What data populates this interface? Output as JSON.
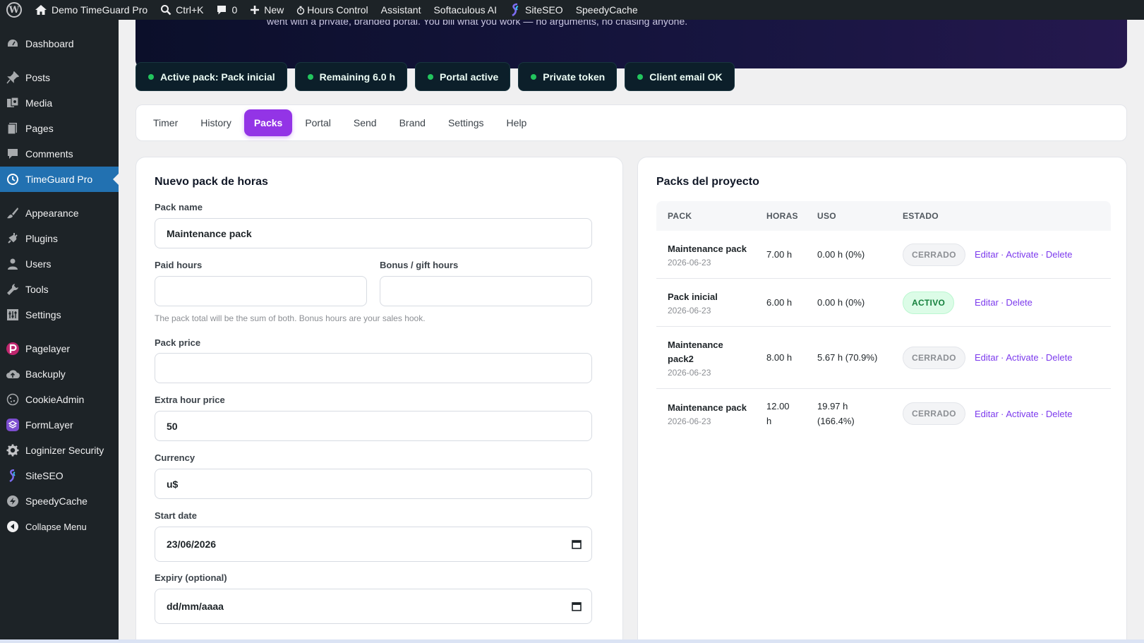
{
  "adminbar": {
    "site_name": "Demo TimeGuard Pro",
    "search_shortcut": "Ctrl+K",
    "comments_count": "0",
    "new_label": "New",
    "hours_control": "Hours Control",
    "assistant": "Assistant",
    "softaculous": "Softaculous AI",
    "siteseo": "SiteSEO",
    "speedycache": "SpeedyCache"
  },
  "sidebar": {
    "items": [
      {
        "label": "Dashboard",
        "icon": "dashboard-icon"
      },
      {
        "label": "Posts",
        "icon": "pin-icon"
      },
      {
        "label": "Media",
        "icon": "media-icon"
      },
      {
        "label": "Pages",
        "icon": "pages-icon"
      },
      {
        "label": "Comments",
        "icon": "comment-icon"
      },
      {
        "label": "TimeGuard Pro",
        "icon": "clock-icon",
        "active": true
      },
      {
        "label": "Appearance",
        "icon": "brush-icon"
      },
      {
        "label": "Plugins",
        "icon": "plug-icon"
      },
      {
        "label": "Users",
        "icon": "user-icon"
      },
      {
        "label": "Tools",
        "icon": "wrench-icon"
      },
      {
        "label": "Settings",
        "icon": "settings-icon"
      },
      {
        "label": "Pagelayer",
        "icon": "pagelayer-icon"
      },
      {
        "label": "Backuply",
        "icon": "cloud-upload-icon"
      },
      {
        "label": "CookieAdmin",
        "icon": "cookie-icon"
      },
      {
        "label": "FormLayer",
        "icon": "formlayer-icon"
      },
      {
        "label": "Loginizer Security",
        "icon": "gear-icon"
      },
      {
        "label": "SiteSEO",
        "icon": "siteseo-icon"
      },
      {
        "label": "SpeedyCache",
        "icon": "speedycache-icon"
      },
      {
        "label": "Collapse Menu",
        "icon": "collapse-icon"
      }
    ]
  },
  "hero": {
    "text": "went with a private, branded portal. You bill what you work — no arguments, no chasing anyone."
  },
  "chips": [
    "Active pack: Pack inicial",
    "Remaining 6.0 h",
    "Portal active",
    "Private token",
    "Client email OK"
  ],
  "tabs": [
    "Timer",
    "History",
    "Packs",
    "Portal",
    "Send",
    "Brand",
    "Settings",
    "Help"
  ],
  "form": {
    "title": "Nuevo pack de horas",
    "pack_name_label": "Pack name",
    "pack_name_value": "Maintenance pack",
    "paid_hours_label": "Paid hours",
    "bonus_hours_label": "Bonus / gift hours",
    "hint": "The pack total will be the sum of both. Bonus hours are your sales hook.",
    "pack_price_label": "Pack price",
    "extra_hour_label": "Extra hour price",
    "extra_hour_value": "50",
    "currency_label": "Currency",
    "currency_value": "u$",
    "start_date_label": "Start date",
    "start_date_value": "23/06/2026",
    "expiry_label": "Expiry (optional)",
    "expiry_value": "dd/mm/aaaa"
  },
  "packs": {
    "title": "Packs del proyecto",
    "headers": {
      "pack": "PACK",
      "horas": "HORAS",
      "uso": "USO",
      "estado": "ESTADO"
    },
    "rows": [
      {
        "name": "Maintenance pack",
        "date": "2026-06-23",
        "horas": "7.00 h",
        "uso": "0.00 h (0%)",
        "estado": "CERRADO",
        "editar": "Editar",
        "activate": "Activate",
        "delete": "Delete"
      },
      {
        "name": "Pack inicial",
        "date": "2026-06-23",
        "horas": "6.00 h",
        "uso": "0.00 h (0%)",
        "estado": "ACTIVO",
        "editar": "Editar",
        "activate": "",
        "delete": "Delete"
      },
      {
        "name": "Maintenance pack2",
        "date": "2026-06-23",
        "horas": "8.00 h",
        "uso": "5.67 h (70.9%)",
        "estado": "CERRADO",
        "editar": "Editar",
        "activate": "Activate",
        "delete": "Delete"
      },
      {
        "name": "Maintenance pack",
        "date": "2026-06-23",
        "horas": "12.00 h",
        "uso": "19.97 h (166.4%)",
        "estado": "CERRADO",
        "editar": "Editar",
        "activate": "Activate",
        "delete": "Delete"
      }
    ]
  },
  "colors": {
    "accent": "#9334e6",
    "wp_blue": "#2271b1",
    "status_green": "#22c55e",
    "link": "#7c3aed"
  }
}
